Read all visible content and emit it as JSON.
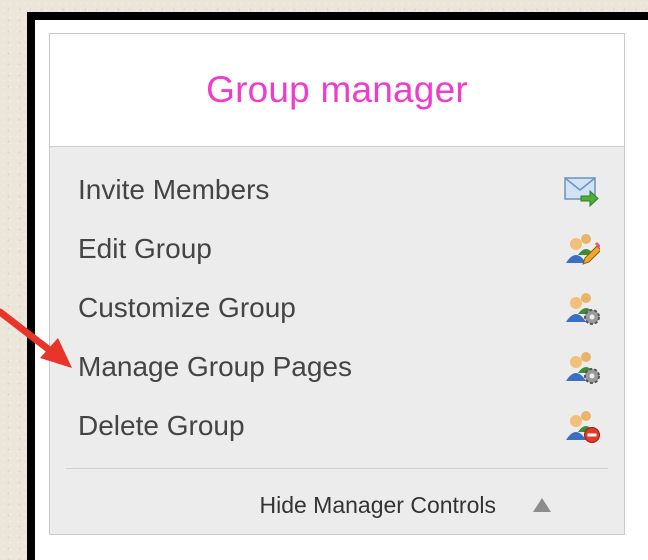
{
  "panel": {
    "title": "Group manager",
    "items": [
      {
        "label": "Invite Members",
        "icon": "invite-envelope-icon"
      },
      {
        "label": "Edit Group",
        "icon": "edit-group-icon"
      },
      {
        "label": "Customize Group",
        "icon": "customize-group-icon"
      },
      {
        "label": "Manage Group Pages",
        "icon": "manage-pages-icon"
      },
      {
        "label": "Delete Group",
        "icon": "delete-group-icon"
      }
    ],
    "footer": {
      "label": "Hide Manager Controls",
      "icon": "triangle-up-icon"
    }
  },
  "colors": {
    "title": "#f03ccd",
    "annotation_arrow": "#e8352a",
    "frame": "#000000",
    "panel_bg": "#ececec"
  }
}
